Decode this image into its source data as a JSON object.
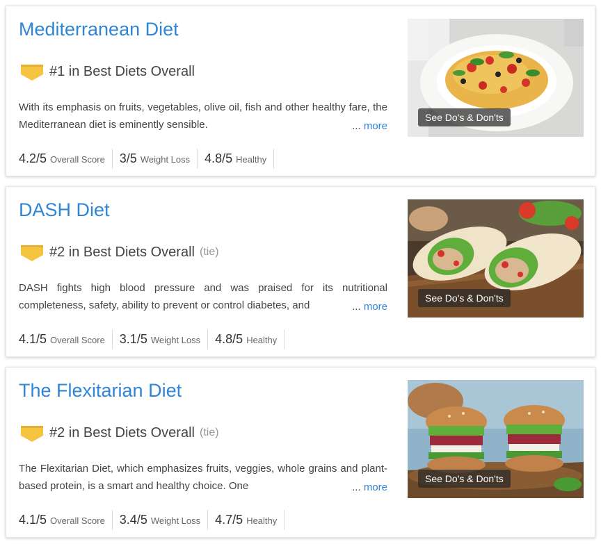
{
  "diets": [
    {
      "title": "Mediterranean Diet",
      "rank": "#1 in Best Diets Overall",
      "tie": "",
      "description": "With its emphasis on fruits, vegetables, olive oil, fish and other healthy fare, the Mediterranean diet is eminently sensible.",
      "more_dots": "...",
      "more_label": "more",
      "scores": [
        {
          "value": "4.2/5",
          "label": "Overall Score"
        },
        {
          "value": "3/5",
          "label": "Weight Loss"
        },
        {
          "value": "4.8/5",
          "label": "Healthy"
        }
      ],
      "image_button": "See Do's & Don'ts",
      "image_icon": "pasta-dish-image"
    },
    {
      "title": "DASH Diet",
      "rank": "#2 in Best Diets Overall",
      "tie": "(tie)",
      "description": "DASH fights high blood pressure and was praised for its nutritional completeness, safety, ability to prevent or control diabetes, and",
      "more_dots": "...",
      "more_label": "more",
      "scores": [
        {
          "value": "4.1/5",
          "label": "Overall Score"
        },
        {
          "value": "3.1/5",
          "label": "Weight Loss"
        },
        {
          "value": "4.8/5",
          "label": "Healthy"
        }
      ],
      "image_button": "See Do's & Don'ts",
      "image_icon": "wrap-sandwich-image"
    },
    {
      "title": "The Flexitarian Diet",
      "rank": "#2 in Best Diets Overall",
      "tie": "(tie)",
      "description": "The Flexitarian Diet, which emphasizes fruits, veggies, whole grains and plant-based protein, is a smart and healthy choice. One",
      "more_dots": "...",
      "more_label": "more",
      "scores": [
        {
          "value": "4.1/5",
          "label": "Overall Score"
        },
        {
          "value": "3.4/5",
          "label": "Weight Loss"
        },
        {
          "value": "4.7/5",
          "label": "Healthy"
        }
      ],
      "image_button": "See Do's & Don'ts",
      "image_icon": "veggie-burger-image"
    }
  ],
  "colors": {
    "title": "#2f86d6",
    "badge": "#f5c542",
    "text": "#444444"
  }
}
